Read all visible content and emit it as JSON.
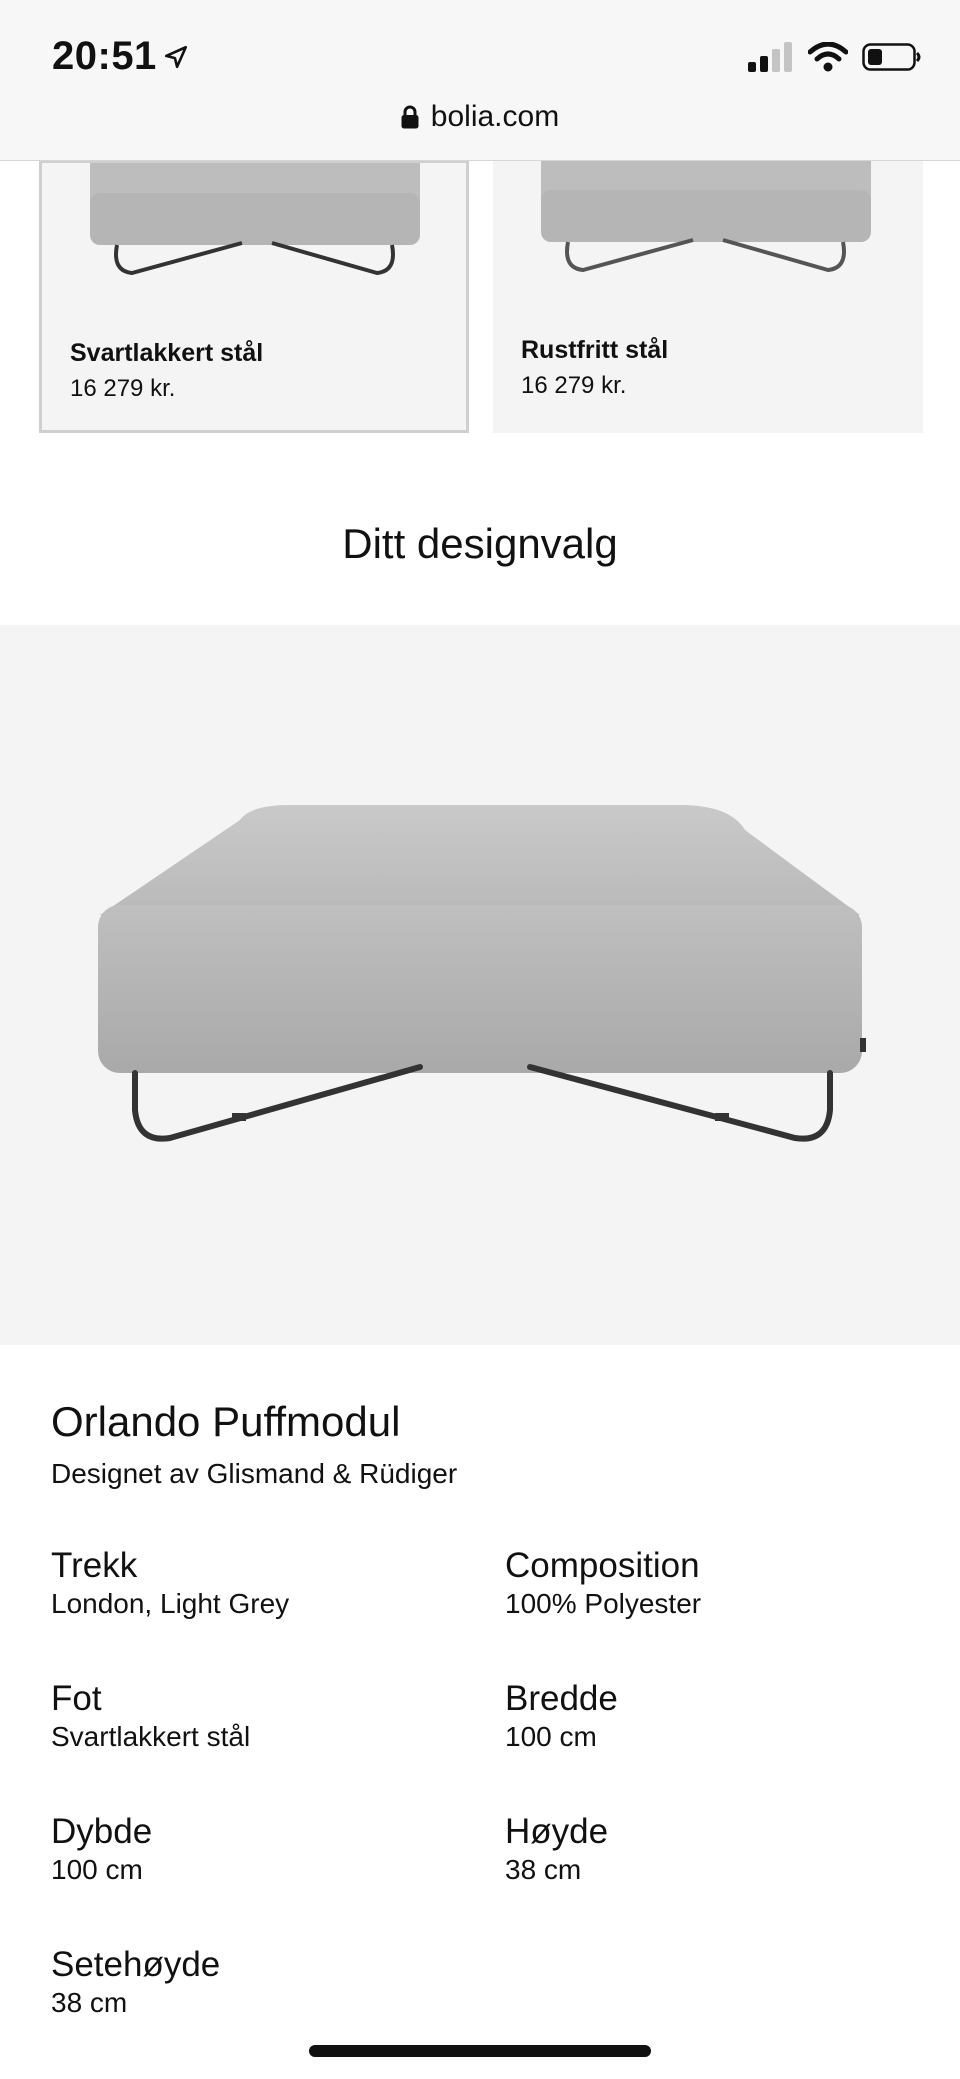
{
  "status_bar": {
    "time": "20:51",
    "icons": [
      "location-arrow-icon",
      "cellular-signal-icon",
      "wifi-icon",
      "battery-icon"
    ]
  },
  "browser": {
    "url": "bolia.com",
    "lock_icon": "lock-icon"
  },
  "variants": [
    {
      "name": "Svartlakkert stål",
      "price": "16 279 kr.",
      "selected": true
    },
    {
      "name": "Rustfritt stål",
      "price": "16 279 kr.",
      "selected": false
    }
  ],
  "design_section": {
    "title": "Ditt designvalg"
  },
  "product": {
    "name": "Orlando Puffmodul",
    "designer": "Designet av Glismand & Rüdiger",
    "specs": [
      {
        "label": "Trekk",
        "value": "London, Light Grey"
      },
      {
        "label": "Composition",
        "value": "100% Polyester"
      },
      {
        "label": "Fot",
        "value": "Svartlakkert stål"
      },
      {
        "label": "Bredde",
        "value": "100 cm"
      },
      {
        "label": "Dybde",
        "value": "100 cm"
      },
      {
        "label": "Høyde",
        "value": "38 cm"
      },
      {
        "label": "Setehøyde",
        "value": "38 cm"
      }
    ]
  },
  "colors": {
    "panel_background": "#f4f4f4",
    "fabric": "#bdbdbd",
    "legs": "#333333"
  }
}
